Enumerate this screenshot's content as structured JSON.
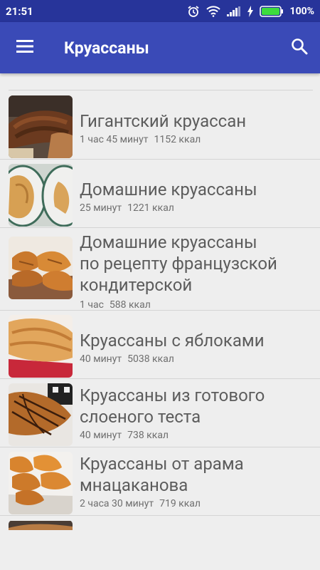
{
  "status": {
    "time": "21:51",
    "battery": "100%"
  },
  "app": {
    "title": "Круассаны"
  },
  "recipes": [
    {
      "title_lines": [
        "Гигантский круассан"
      ],
      "time": "1 час 45 минут",
      "kcal": "1152 ккал"
    },
    {
      "title_lines": [
        "Домашние круассаны"
      ],
      "time": "25 минут",
      "kcal": "1221 ккал"
    },
    {
      "title_lines": [
        "Домашние круассаны",
        "по рецепту французской",
        "кондитерской"
      ],
      "time": "1 час",
      "kcal": "588 ккал"
    },
    {
      "title_lines": [
        "Круассаны с яблоками"
      ],
      "time": "40 минут",
      "kcal": "5038 ккал"
    },
    {
      "title_lines": [
        "Круассаны из готового",
        "слоеного теста"
      ],
      "time": "40 минут",
      "kcal": "738 ккал"
    },
    {
      "title_lines": [
        "Круассаны от арама",
        "мнацаканова"
      ],
      "time": "2 часа 30 минут",
      "kcal": "719 ккал"
    }
  ]
}
